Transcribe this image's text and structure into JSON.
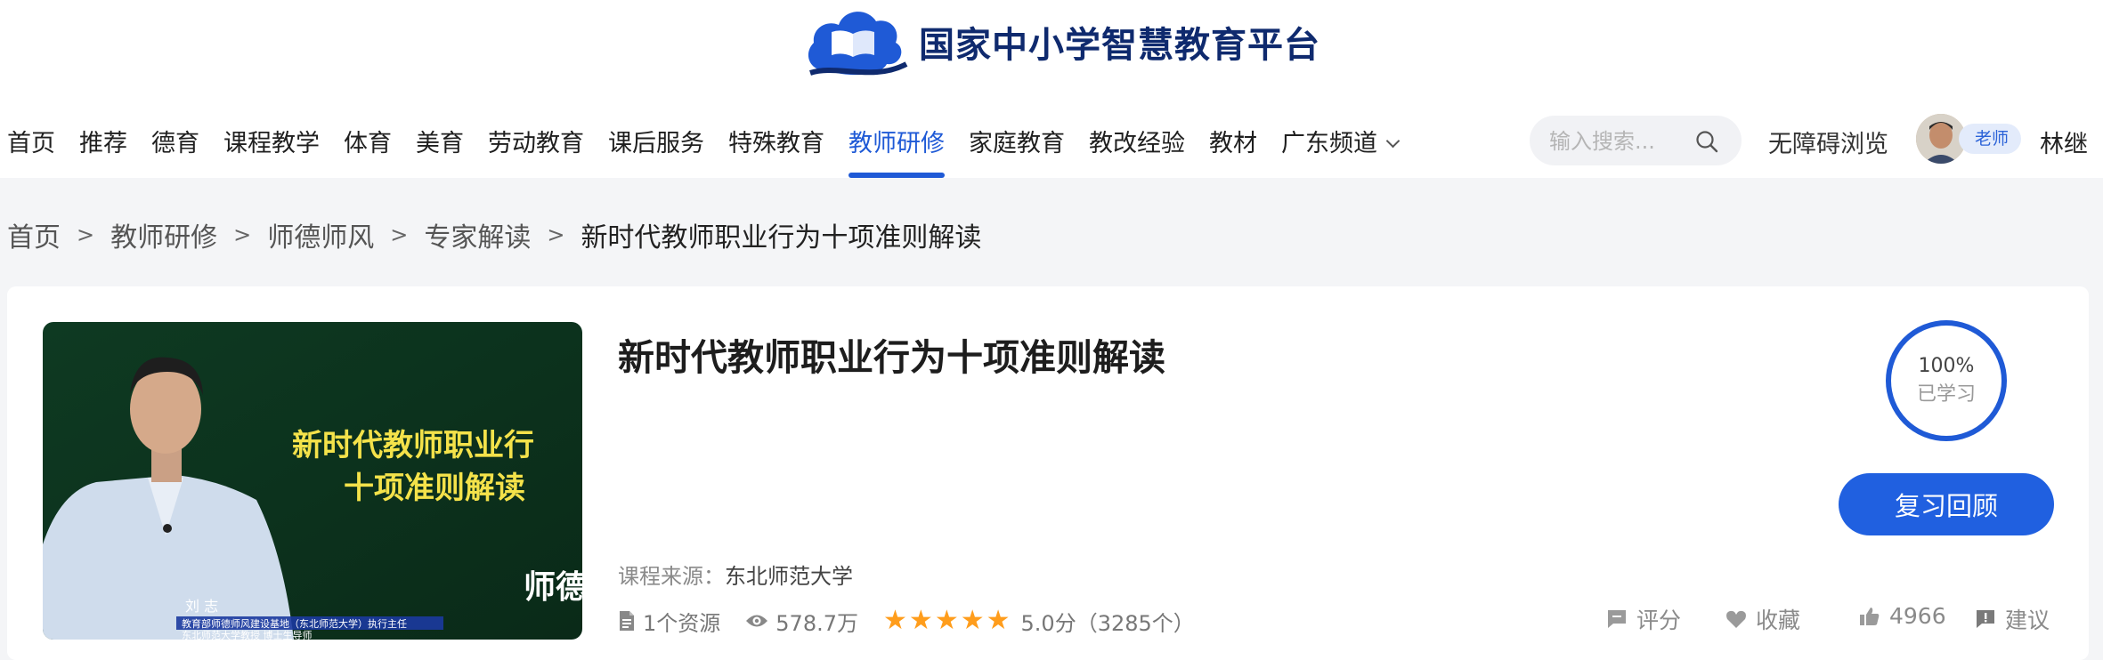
{
  "header": {
    "logo_text": "国家中小学智慧教育平台",
    "nav": [
      {
        "label": "首页"
      },
      {
        "label": "推荐"
      },
      {
        "label": "德育"
      },
      {
        "label": "课程教学"
      },
      {
        "label": "体育"
      },
      {
        "label": "美育"
      },
      {
        "label": "劳动教育"
      },
      {
        "label": "课后服务"
      },
      {
        "label": "特殊教育"
      },
      {
        "label": "教师研修",
        "active": true
      },
      {
        "label": "家庭教育"
      },
      {
        "label": "教改经验"
      },
      {
        "label": "教材"
      },
      {
        "label": "广东频道"
      }
    ],
    "search_placeholder": "输入搜索...",
    "accessibility_label": "无障碍浏览",
    "user": {
      "role_badge": "老师",
      "name": "林继"
    },
    "accent_color": "#1f5ad6"
  },
  "breadcrumb": {
    "items": [
      "首页",
      "教师研修",
      "师德师风",
      "专家解读"
    ],
    "current": "新时代教师职业行为十项准则解读",
    "separator": ">"
  },
  "course": {
    "title": "新时代教师职业行为十项准则解读",
    "thumbnail": {
      "board_line1": "新时代教师职业行",
      "board_line2": "十项准则解读",
      "speaker_name": "刘 志",
      "caption_line1": "教育部师德师风建设基地（东北师范大学）执行主任",
      "caption_line2": "东北师范大学教授 博士生导师",
      "corner_logo": "师德"
    },
    "source_label": "课程来源：",
    "source_value": "东北师范大学",
    "resource_count": "1个资源",
    "views": "578.7万",
    "rating": {
      "stars": 5,
      "score": "5.0分",
      "count": "（3285个）"
    },
    "progress": {
      "percent": "100%",
      "label": "已学习",
      "value": 1.0
    },
    "review_button": "复习回顾",
    "actions": {
      "rate": "评分",
      "favorite": "收藏",
      "likes": "4966",
      "suggest": "建议"
    }
  }
}
